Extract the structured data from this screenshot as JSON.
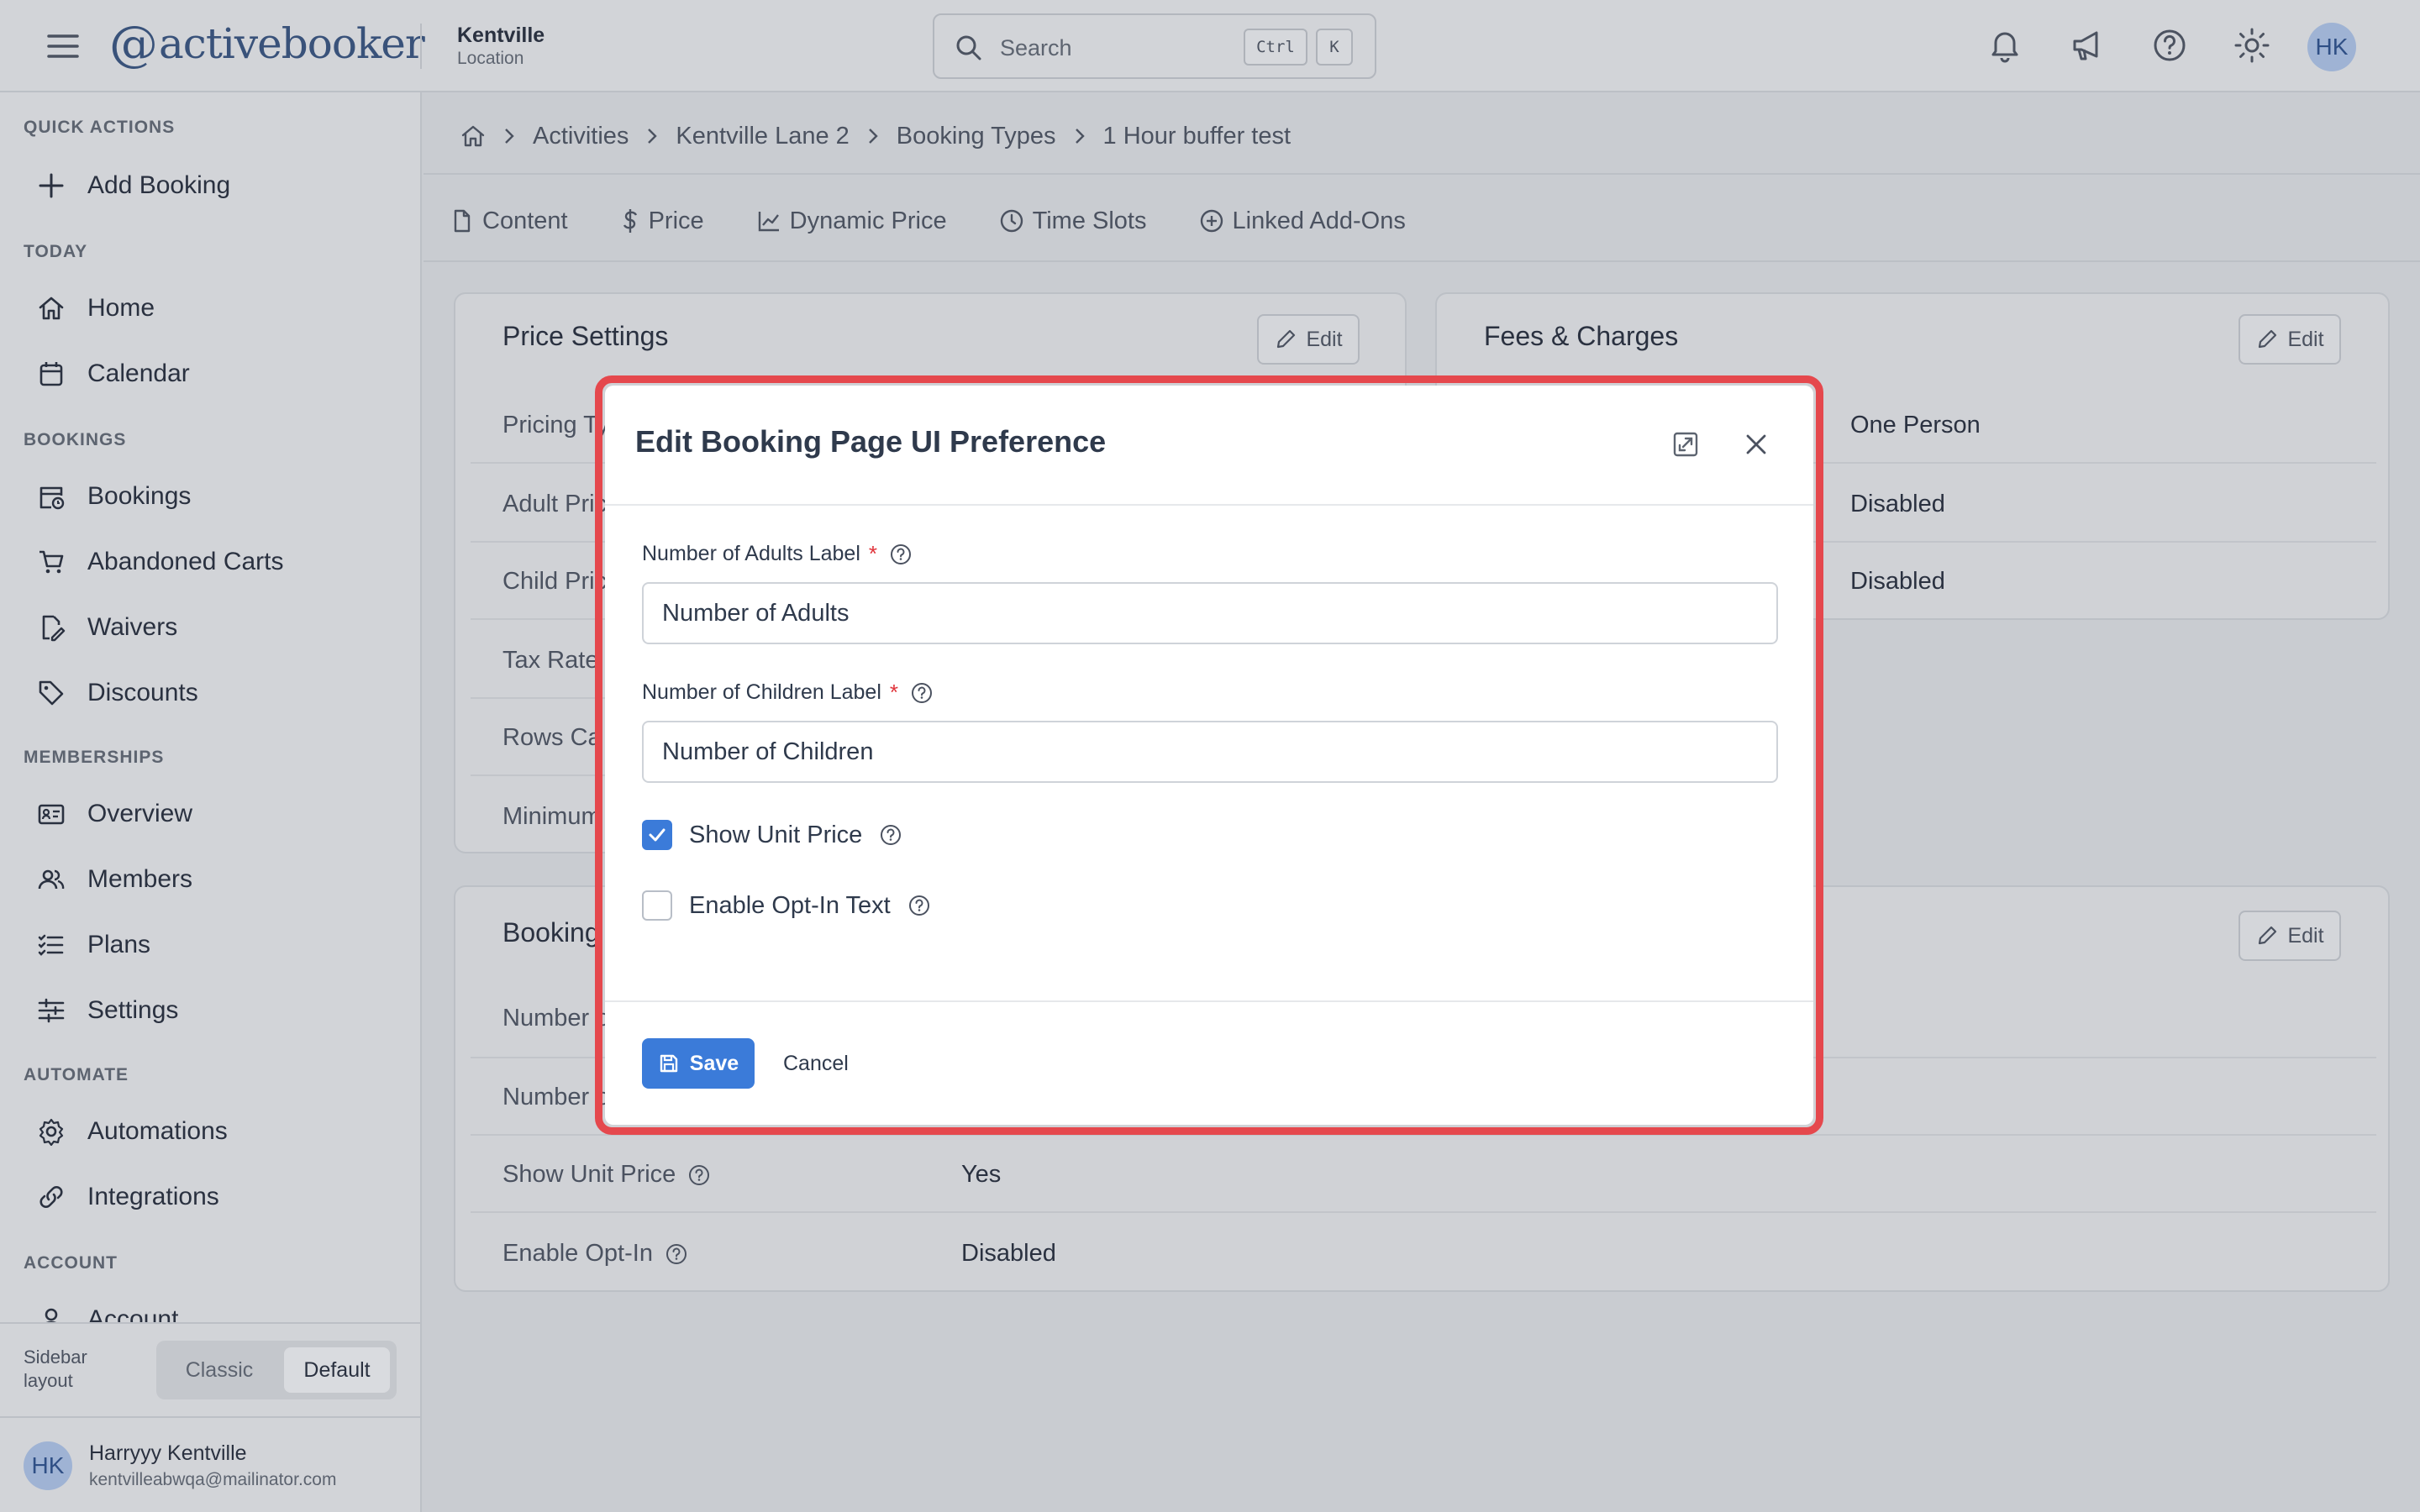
{
  "header": {
    "brand": "activebooker",
    "location_name": "Kentville",
    "location_sub": "Location",
    "search_placeholder": "Search",
    "shortcut_ctrl": "Ctrl",
    "shortcut_k": "K",
    "avatar_initials": "HK",
    "icons": [
      "menu-icon",
      "bell-icon",
      "megaphone-icon",
      "help-icon",
      "sun-icon"
    ]
  },
  "sidebar": {
    "sections": {
      "quick_actions": "QUICK ACTIONS",
      "today": "TODAY",
      "bookings": "BOOKINGS",
      "memberships": "MEMBERSHIPS",
      "automate": "AUTOMATE",
      "account": "ACCOUNT"
    },
    "items": {
      "add_booking": "Add Booking",
      "home": "Home",
      "calendar": "Calendar",
      "bookings": "Bookings",
      "abandoned_carts": "Abandoned Carts",
      "waivers": "Waivers",
      "discounts": "Discounts",
      "overview": "Overview",
      "members": "Members",
      "plans": "Plans",
      "settings": "Settings",
      "automations": "Automations",
      "integrations": "Integrations",
      "account": "Account"
    },
    "layout_label": "Sidebar layout",
    "layout_options": {
      "classic": "Classic",
      "default": "Default"
    },
    "layout_selected": "Default",
    "user": {
      "initials": "HK",
      "name": "Harryyy Kentville",
      "email": "kentvilleabwqa@mailinator.com"
    }
  },
  "breadcrumb": [
    "Activities",
    "Kentville Lane 2",
    "Booking Types",
    "1 Hour buffer test"
  ],
  "tabs": [
    "Content",
    "Price",
    "Dynamic Price",
    "Time Slots",
    "Linked Add-Ons"
  ],
  "price_settings": {
    "title": "Price Settings",
    "edit": "Edit",
    "rows": [
      "Pricing Ty",
      "Adult Pric",
      "Child Pric",
      "Tax Rate",
      "Rows Ca",
      "Minimum"
    ]
  },
  "fees": {
    "title": "Fees & Charges",
    "edit": "Edit",
    "values": [
      "One Person",
      "Disabled",
      "Disabled"
    ]
  },
  "booking_card": {
    "title": "Booking",
    "edit": "Edit",
    "rows": [
      {
        "label": "Number o",
        "value": ""
      },
      {
        "label": "Number o",
        "value": ""
      },
      {
        "label": "Show Unit Price",
        "value": "Yes"
      },
      {
        "label": "Enable Opt-In",
        "value": "Disabled"
      }
    ]
  },
  "modal": {
    "title": "Edit Booking Page UI Preference",
    "adults_label": "Number of Adults Label",
    "adults_value": "Number of Adults",
    "children_label": "Number of Children Label",
    "children_value": "Number of Children",
    "required_mark": "*",
    "show_unit_price": {
      "label": "Show Unit Price",
      "checked": true
    },
    "enable_opt_in": {
      "label": "Enable Opt-In Text",
      "checked": false
    },
    "save": "Save",
    "cancel": "Cancel",
    "highlight_color": "#e5484d",
    "accent": "#3b7bd9"
  }
}
